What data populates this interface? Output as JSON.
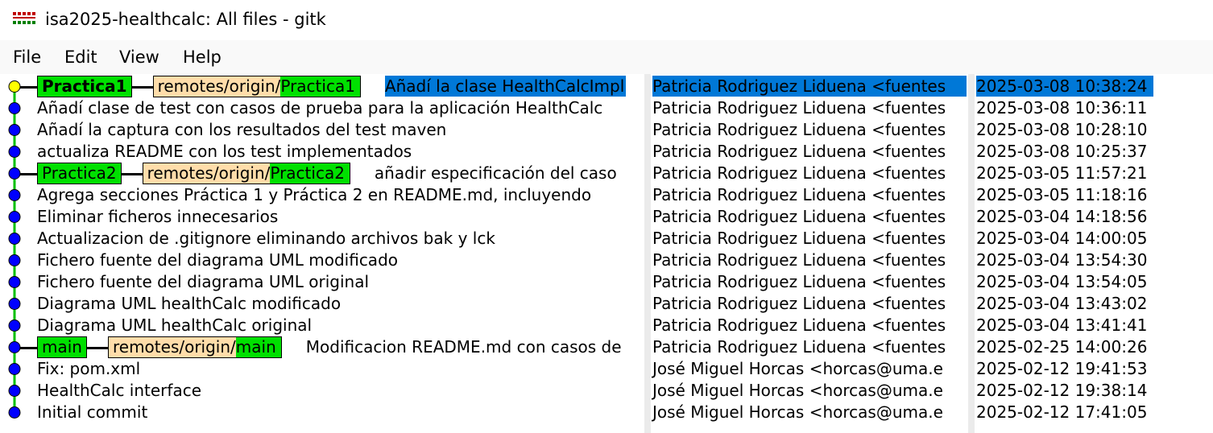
{
  "window": {
    "title": "isa2025-healthcalc: All files - gitk",
    "icon": "gitk-app-icon"
  },
  "menu": [
    "File",
    "Edit",
    "View",
    "Help"
  ],
  "colors": {
    "local_branch": "#00e000",
    "remote_prefix": "#ffddaa",
    "selection": "#0078d7",
    "node": "#0000ff",
    "head_node": "#ffff00",
    "graph_line": "#00c000"
  },
  "commits": [
    {
      "message": "Añadí la clase HealthCalcImpl",
      "refs": {
        "head": "Practica1",
        "remote_prefix": "remotes/origin/",
        "remote_name": "Practica1"
      },
      "author": "Patricia Rodriguez Liduena <fuentes",
      "date": "2025-03-08 10:38:24",
      "selected": true,
      "head": true
    },
    {
      "message": "Añadí clase de test con casos de prueba para la aplicación HealthCalc",
      "author": "Patricia Rodriguez Liduena <fuentes",
      "date": "2025-03-08 10:36:11"
    },
    {
      "message": "Añadí la captura con los resultados del test maven",
      "author": "Patricia Rodriguez Liduena <fuentes",
      "date": "2025-03-08 10:28:10"
    },
    {
      "message": "actualiza README con los test implementados",
      "author": "Patricia Rodriguez Liduena <fuentes",
      "date": "2025-03-08 10:25:37"
    },
    {
      "message": "añadir especificación del caso",
      "refs": {
        "head": "Practica2",
        "remote_prefix": "remotes/origin/",
        "remote_name": "Practica2"
      },
      "author": "Patricia Rodriguez Liduena <fuentes",
      "date": "2025-03-05 11:57:21"
    },
    {
      "message": "Agrega secciones Práctica 1 y Práctica 2 en README.md, incluyendo",
      "author": "Patricia Rodriguez Liduena <fuentes",
      "date": "2025-03-05 11:18:16"
    },
    {
      "message": "Eliminar ficheros innecesarios",
      "author": "Patricia Rodriguez Liduena <fuentes",
      "date": "2025-03-04 14:18:56"
    },
    {
      "message": "Actualizacion de .gitignore eliminando archivos bak y lck",
      "author": "Patricia Rodriguez Liduena <fuentes",
      "date": "2025-03-04 14:00:05"
    },
    {
      "message": "Fichero fuente del diagrama UML modificado",
      "author": "Patricia Rodriguez Liduena <fuentes",
      "date": "2025-03-04 13:54:30"
    },
    {
      "message": "Fichero fuente del diagrama UML original",
      "author": "Patricia Rodriguez Liduena <fuentes",
      "date": "2025-03-04 13:54:05"
    },
    {
      "message": "Diagrama UML healthCalc modificado",
      "author": "Patricia Rodriguez Liduena <fuentes",
      "date": "2025-03-04 13:43:02"
    },
    {
      "message": "Diagrama UML healthCalc original",
      "author": "Patricia Rodriguez Liduena <fuentes",
      "date": "2025-03-04 13:41:41"
    },
    {
      "message": "Modificacion README.md con casos de",
      "refs": {
        "head": "main",
        "remote_prefix": "remotes/origin/",
        "remote_name": "main"
      },
      "author": "Patricia Rodriguez Liduena <fuentes",
      "date": "2025-02-25 14:00:26"
    },
    {
      "message": "Fix: pom.xml",
      "author": "José Miguel Horcas <horcas@uma.e",
      "date": "2025-02-12 19:41:53"
    },
    {
      "message": "HealthCalc interface",
      "author": "José Miguel Horcas <horcas@uma.e",
      "date": "2025-02-12 19:38:14"
    },
    {
      "message": "Initial commit",
      "author": "José Miguel Horcas <horcas@uma.e",
      "date": "2025-02-12 17:41:05"
    }
  ]
}
